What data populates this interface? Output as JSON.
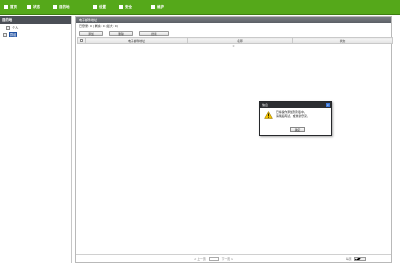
{
  "topnav": {
    "items": [
      {
        "label": "首页",
        "icon": "home-icon"
      },
      {
        "label": "状态",
        "icon": "status-icon"
      },
      {
        "label": "目的地",
        "icon": "destination-icon"
      },
      {
        "label": "设置",
        "icon": "settings-icon"
      },
      {
        "label": "安全",
        "icon": "security-icon"
      },
      {
        "label": "维护",
        "icon": "maintenance-icon"
      }
    ],
    "bg_color": "#55a81a"
  },
  "sidebar": {
    "title": "目的地",
    "items": [
      {
        "label": "个人"
      },
      {
        "label": "群组"
      }
    ]
  },
  "main": {
    "title": "电子邮件地址",
    "summary": "已登录: 0 | 剩余: 0 (最大: 0)",
    "toolbar": {
      "add_label": "添加",
      "delete_label": "删除",
      "search_label": "搜索"
    },
    "columns": [
      "电子邮件地址",
      "名称",
      "状态"
    ],
    "empty_marker": "0",
    "pager": {
      "prev_label": "< 上一页",
      "next_label": "下一页 >",
      "per_page_label": "每页",
      "per_page_value": "20"
    }
  },
  "dialog": {
    "title": "信息",
    "message_line1": "已将操作添加到列表中。",
    "message_line2": "请稍后再试，或重新登录。",
    "ok_label": "确定",
    "close_symbol": "×"
  }
}
